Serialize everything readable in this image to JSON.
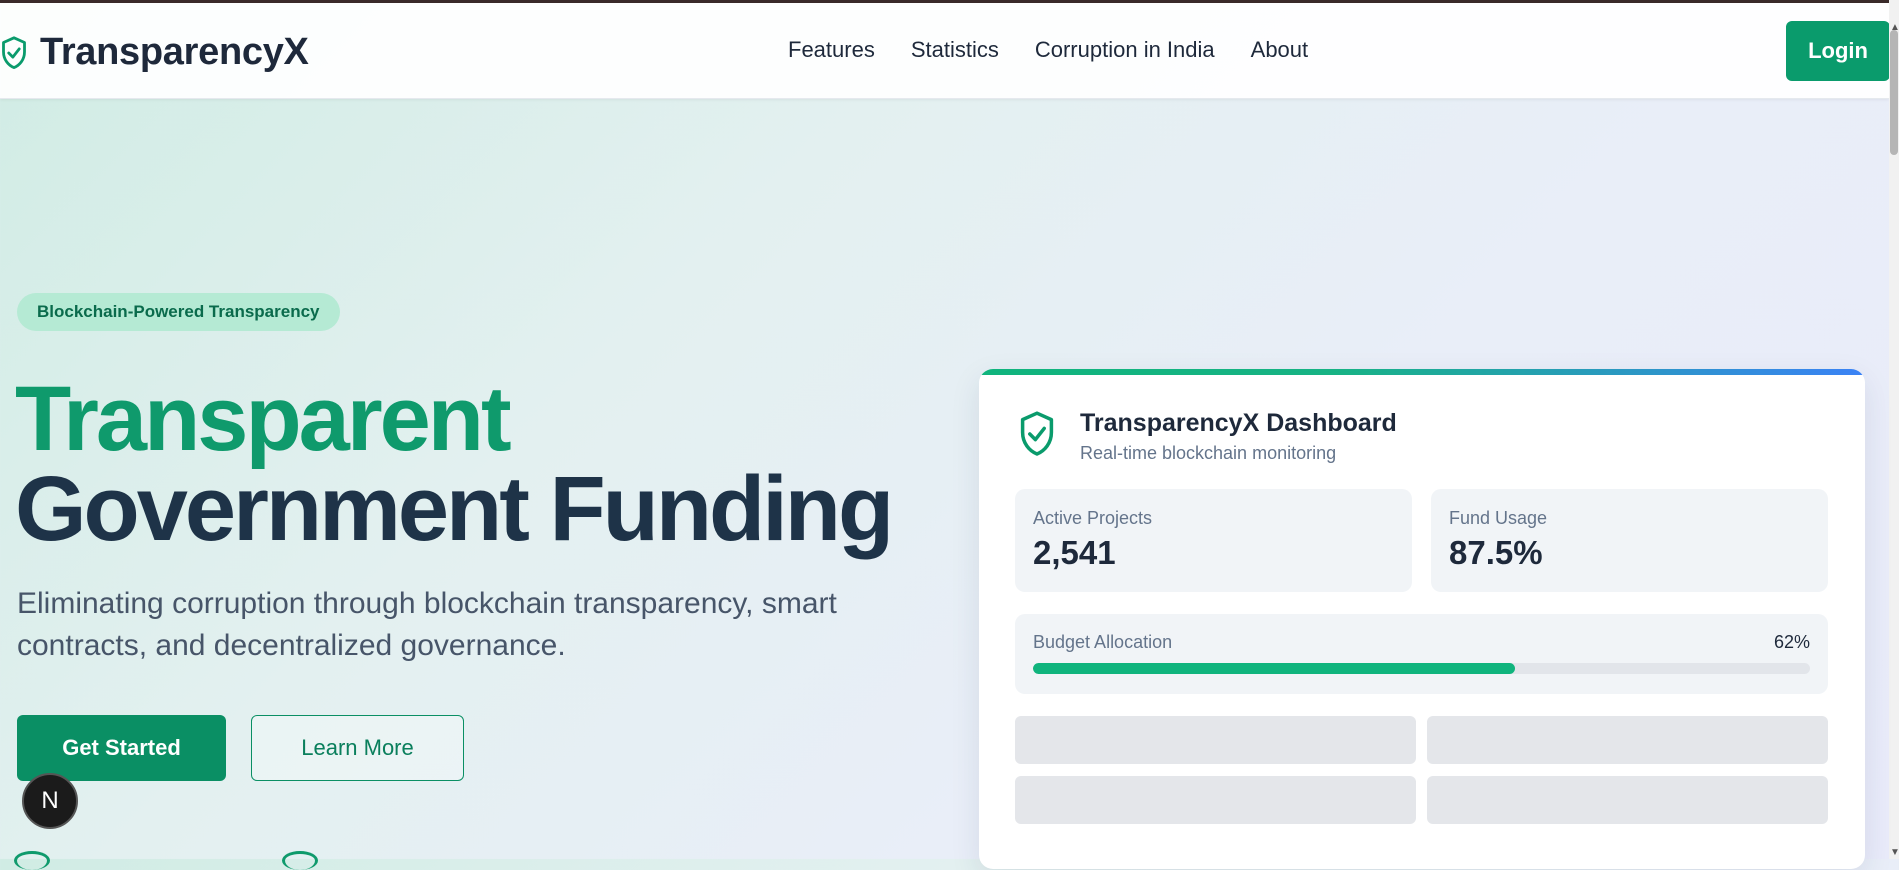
{
  "navbar": {
    "brand": "TransparencyX",
    "links": [
      "Features",
      "Statistics",
      "Corruption in India",
      "About"
    ],
    "login_label": "Login"
  },
  "hero": {
    "badge": "Blockchain-Powered Transparency",
    "title_line1": "Transparent",
    "title_line2": "Government Funding",
    "subtitle": "Eliminating corruption through blockchain transparency, smart contracts, and decentralized governance.",
    "primary_button": "Get Started",
    "secondary_button": "Learn More"
  },
  "dev_badge": "N",
  "dashboard": {
    "title": "TransparencyX Dashboard",
    "subtitle": "Real-time blockchain monitoring",
    "stats": [
      {
        "label": "Active Projects",
        "value": "2,541"
      },
      {
        "label": "Fund Usage",
        "value": "87.5%"
      }
    ],
    "budget": {
      "label": "Budget Allocation",
      "percent_text": "62%",
      "fraction": 0.62
    }
  },
  "colors": {
    "brand_green": "#0a9b6c",
    "title_green": "#0f9a6c",
    "title_dark": "#1e3348",
    "progress_green": "#10b47d",
    "accent_blue": "#3b82f6"
  },
  "icons": {
    "brand": "shield-check-icon",
    "dashboard": "shield-check-icon"
  }
}
